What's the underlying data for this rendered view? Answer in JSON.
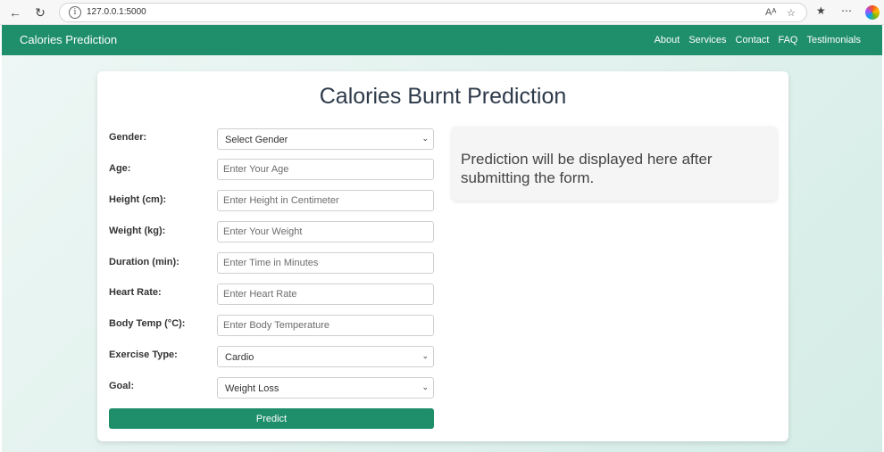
{
  "browser": {
    "url": "127.0.0.1:5000",
    "read_aloud_label": "Aᴬ"
  },
  "navbar": {
    "brand": "Calories Prediction",
    "links": [
      "About",
      "Services",
      "Contact",
      "FAQ",
      "Testimonials"
    ]
  },
  "main": {
    "title": "Calories Burnt Prediction",
    "form": {
      "gender": {
        "label": "Gender:",
        "value": "Select Gender"
      },
      "age": {
        "label": "Age:",
        "placeholder": "Enter Your Age"
      },
      "height": {
        "label": "Height (cm):",
        "placeholder": "Enter Height in Centimeter"
      },
      "weight": {
        "label": "Weight (kg):",
        "placeholder": "Enter Your Weight"
      },
      "duration": {
        "label": "Duration (min):",
        "placeholder": "Enter Time in Minutes"
      },
      "heart_rate": {
        "label": "Heart Rate:",
        "placeholder": "Enter Heart Rate"
      },
      "body_temp": {
        "label": "Body Temp (°C):",
        "placeholder": "Enter Body Temperature"
      },
      "exercise_type": {
        "label": "Exercise Type:",
        "value": "Cardio"
      },
      "goal": {
        "label": "Goal:",
        "value": "Weight Loss"
      },
      "submit_label": "Predict"
    },
    "result_text": "Prediction will be displayed here after submitting the form."
  },
  "colors": {
    "primary": "#1e8e6b",
    "title_text": "#2d3a4a"
  }
}
